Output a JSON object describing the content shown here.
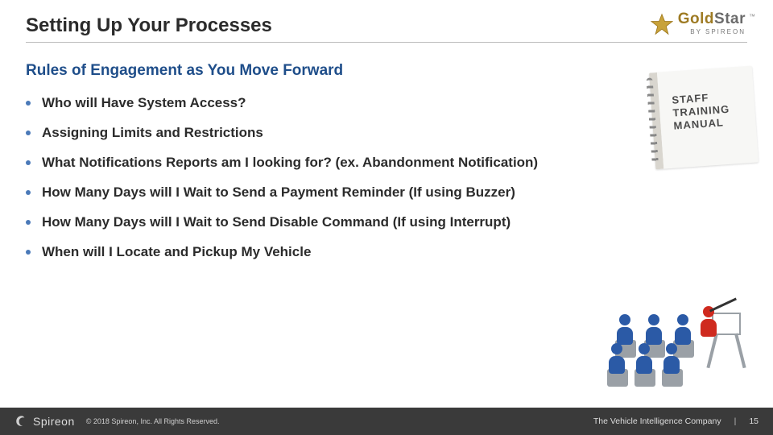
{
  "header": {
    "title": "Setting Up Your Processes",
    "brand": {
      "gold": "Gold",
      "star": "Star",
      "byline": "BY SPIREON",
      "tm": "™"
    }
  },
  "subhead": "Rules of Engagement as You Move Forward",
  "bullets": [
    "Who will Have System Access?",
    "Assigning Limits and Restrictions",
    "What Notifications Reports am I looking for? (ex. Abandonment Notification)",
    "How Many Days will I Wait to Send a Payment Reminder (If using Buzzer)",
    "How Many Days will I Wait to Send Disable Command (If using Interrupt)",
    "When will I Locate and Pickup My Vehicle"
  ],
  "manual": {
    "line1": "STAFF",
    "line2": "TRAINING",
    "line3": "MANUAL"
  },
  "footer": {
    "brand": "Spireon",
    "copyright": "© 2018 Spireon, Inc. All Rights Reserved.",
    "tagline": "The Vehicle Intelligence Company",
    "separator": "|",
    "page_number": "15"
  }
}
